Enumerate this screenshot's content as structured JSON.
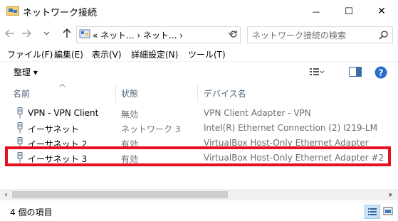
{
  "window": {
    "title": "ネットワーク接続",
    "minimize_glyph": "—",
    "maximize_glyph": "☐",
    "close_glyph": "✕"
  },
  "address": {
    "breadcrumb": "« ネット... › ネット... ›",
    "search_placeholder": "ネットワーク接続の検索"
  },
  "menu": [
    {
      "label": "ファイル(F)"
    },
    {
      "label": "編集(E)"
    },
    {
      "label": "表示(V)"
    },
    {
      "label": "詳細設定(N)"
    },
    {
      "label": "ツール(T)"
    }
  ],
  "toolbar": {
    "organize_label": "整理 ▾"
  },
  "columns": [
    "名前",
    "状態",
    "デバイス名"
  ],
  "rows": [
    {
      "name": "VPN - VPN Client",
      "status": "無効",
      "device": "VPN Client Adapter - VPN"
    },
    {
      "name": "イーサネット",
      "status": "ネットワーク 3",
      "device": "Intel(R) Ethernet Connection (2) I219-LM"
    },
    {
      "name": "イーサネット 2",
      "status": "有効",
      "device": "VirtualBox Host-Only Ethernet Adapter"
    },
    {
      "name": "イーサネット 3",
      "status": "有効",
      "device": "VirtualBox Host-Only Ethernet Adapter #2"
    }
  ],
  "status": {
    "item_count": "4 個の項目"
  },
  "colors": {
    "highlight": "#e8101e",
    "header_text": "#4c607a",
    "status_gray": "#6d6d6d"
  }
}
